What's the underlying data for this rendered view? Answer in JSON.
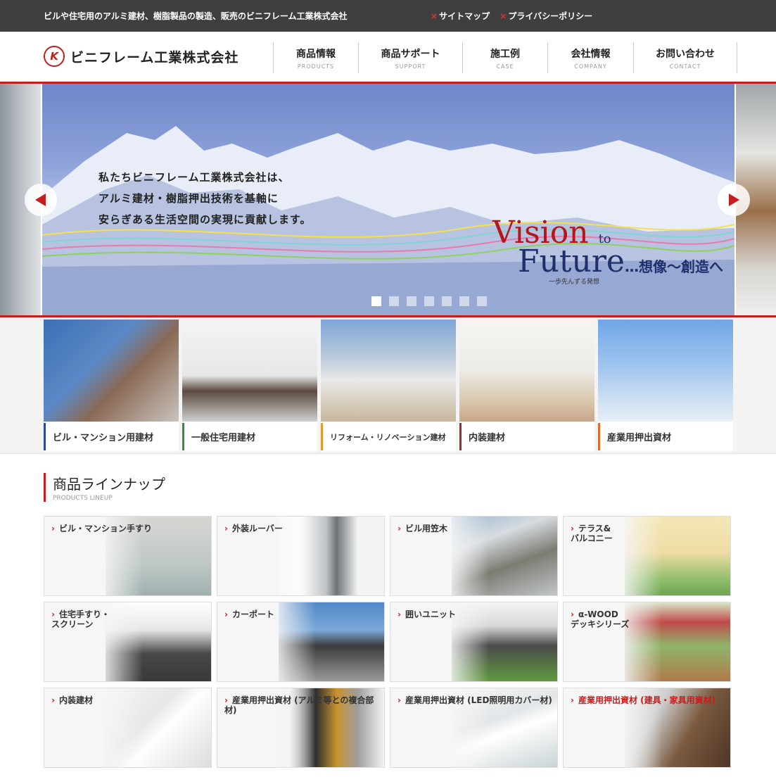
{
  "topbar": {
    "tagline": "ビルや住宅用のアルミ建材、樹脂製品の製造、販売のビニフレーム工業株式会社",
    "links": [
      {
        "label": "サイトマップ"
      },
      {
        "label": "プライバシーポリシー"
      }
    ],
    "marker": "×"
  },
  "header": {
    "logo_mark": "K",
    "logo_text": "ビニフレーム工業株式会社",
    "nav": [
      {
        "jp": "商品情報",
        "en": "PRODUCTS"
      },
      {
        "jp": "商品サポート",
        "en": "SUPPORT"
      },
      {
        "jp": "施工例",
        "en": "CASE"
      },
      {
        "jp": "会社情報",
        "en": "COMPANY"
      },
      {
        "jp": "お問い合わせ",
        "en": "CONTACT"
      }
    ]
  },
  "hero": {
    "message": [
      "私たちビニフレーム工業株式会社は、",
      "アルミ建材・樹脂押出技術を基軸に",
      "安らぎある生活空間の実現に貢献します。"
    ],
    "vision_line1": "Vision",
    "vision_to": "to",
    "vision_line2": "Future",
    "vision_tagline": "…想像〜創造へ",
    "vision_sub": "一歩先んずる発想",
    "dot_count": 7,
    "active_dot": 0
  },
  "categories": [
    {
      "label": "ビル・マンション用建材",
      "accent": "#2a4aa0"
    },
    {
      "label": "一般住宅用建材",
      "accent": "#3d8a3a"
    },
    {
      "label": "リフォーム・リノベーション建材",
      "accent": "#e39a2a"
    },
    {
      "label": "内装建材",
      "accent": "#9a2a3a"
    },
    {
      "label": "産業用押出資材",
      "accent": "#e06a2a"
    }
  ],
  "lineup": {
    "title": "商品ラインナップ",
    "subtitle": "PRODUCTS LINEUP",
    "items": [
      {
        "label": "ビル・マンション手すり"
      },
      {
        "label": "外装ルーバー"
      },
      {
        "label": "ビル用笠木"
      },
      {
        "label": "テラス&\nバルコニー"
      },
      {
        "label": "住宅手すり・\nスクリーン"
      },
      {
        "label": "カーポート"
      },
      {
        "label": "囲いユニット"
      },
      {
        "label": "α-WOOD\nデッキシリーズ"
      },
      {
        "label": "内装建材"
      },
      {
        "label": "産業用押出資材 (アルミ等との複合部材)"
      },
      {
        "label": "産業用押出資材 (LED照明用カバー材)"
      },
      {
        "label": "産業用押出資材 (建具・家具用資材)"
      }
    ]
  },
  "colors": {
    "accent_red": "#c81d1d",
    "topbar": "#3f3f3f"
  }
}
